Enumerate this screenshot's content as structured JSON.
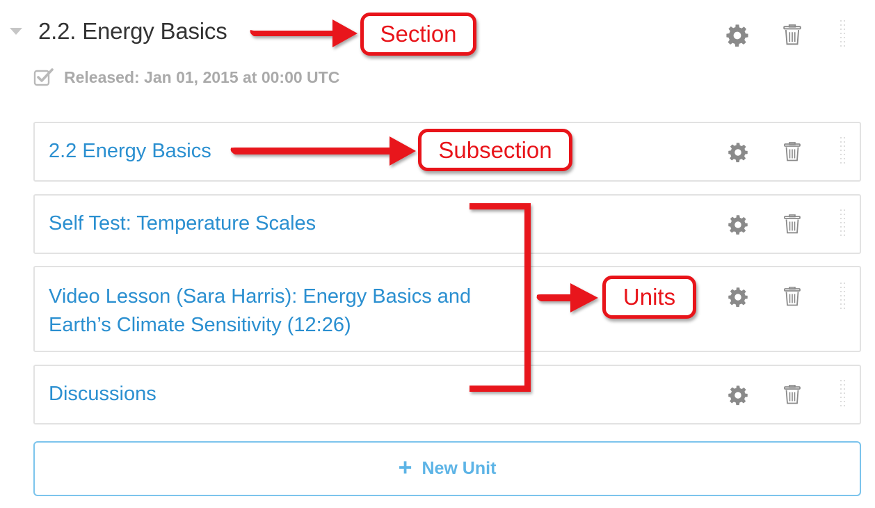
{
  "section": {
    "title": "2.2. Energy Basics",
    "release_text": "Released: Jan 01, 2015 at 00:00 UTC"
  },
  "subsection": {
    "title": "2.2 Energy Basics"
  },
  "units": [
    {
      "lines": [
        "Self Test: Temperature Scales"
      ]
    },
    {
      "lines": [
        "Video Lesson (Sara Harris): Energy Basics and",
        "Earth’s Climate Sensitivity (12:26)"
      ]
    },
    {
      "lines": [
        "Discussions"
      ]
    }
  ],
  "new_unit": {
    "plus": "+",
    "label": "New Unit"
  },
  "annotations": {
    "section": "Section",
    "subsection": "Subsection",
    "units": "Units"
  },
  "icons": {
    "collapse": "caret-down-icon",
    "released": "checkbox-checked-icon",
    "settings": "gear-icon",
    "delete": "trash-icon",
    "drag": "drag-handle-icon",
    "add": "plus-icon"
  },
  "colors": {
    "link": "#2a8fd0",
    "annotation": "#e8141a",
    "new_unit_border": "#7cc4ec",
    "muted": "#aaaaaa"
  }
}
